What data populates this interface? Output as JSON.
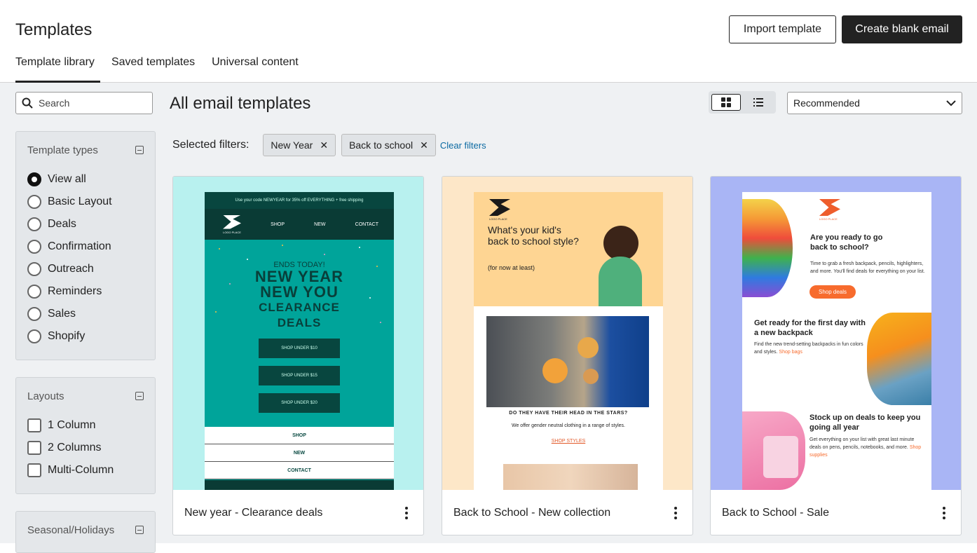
{
  "header": {
    "title": "Templates",
    "import_label": "Import template",
    "create_label": "Create blank email",
    "tabs": [
      {
        "label": "Template library",
        "active": true
      },
      {
        "label": "Saved templates",
        "active": false
      },
      {
        "label": "Universal content",
        "active": false
      }
    ]
  },
  "sidebar": {
    "search_placeholder": "Search",
    "template_types": {
      "title": "Template types",
      "options": [
        "View all",
        "Basic Layout",
        "Deals",
        "Confirmation",
        "Outreach",
        "Reminders",
        "Sales",
        "Shopify"
      ],
      "selected": "View all"
    },
    "layouts": {
      "title": "Layouts",
      "options": [
        "1 Column",
        "2 Columns",
        "Multi-Column"
      ]
    },
    "seasonal": {
      "title": "Seasonal/Holidays"
    }
  },
  "main": {
    "title": "All email templates",
    "sort_value": "Recommended",
    "selected_filters_label": "Selected filters:",
    "filters": [
      "New Year",
      "Back to school"
    ],
    "clear_label": "Clear filters",
    "colors": {
      "accent_link": "#0b6aa2",
      "primary_button": "#222222"
    }
  },
  "cards": [
    {
      "name": "New year - Clearance deals",
      "preview": {
        "bar": "Use your code NEWYEAR for 35% off EVERYTHING + free shipping",
        "logo": "LOGO PLACE",
        "nav": [
          "SHOP",
          "NEW",
          "CONTACT"
        ],
        "kicker": "ENDS TODAY!",
        "line1": "NEW YEAR",
        "line2": "NEW YOU",
        "line3": "CLEARANCE",
        "line4": "DEALS",
        "buttons": [
          "SHOP UNDER $10",
          "SHOP UNDER $15",
          "SHOP UNDER $20"
        ],
        "links": [
          "SHOP",
          "NEW",
          "CONTACT"
        ]
      }
    },
    {
      "name": "Back to School - New collection",
      "preview": {
        "logo": "LOGO PLACE",
        "headline": "What's your kid's back to school style?",
        "sub": "(for now at least)",
        "heading2": "DO THEY HAVE THEIR HEAD IN THE STARS?",
        "body": "We offer gender neutral clothing in a range of styles.",
        "link": "SHOP STYLES"
      }
    },
    {
      "name": "Back to School - Sale",
      "preview": {
        "logo": "LOGO PLACE",
        "h1": "Are you ready to go back to school?",
        "p1": "Time to grab a fresh backpack, pencils, highlighters, and more. You'll find deals for everything on your list.",
        "btn": "Shop deals",
        "h2": "Get ready for the first day with a new backpack",
        "p2": "Find the new trend-setting backpacks in fun colors and styles.",
        "p2link": "Shop bags",
        "h3": "Stock up on deals to keep you going all year",
        "p3": "Get everything on your list with great last minute deals on pens, pencils, notebooks, and more.",
        "p3link": "Shop supplies"
      }
    }
  ]
}
